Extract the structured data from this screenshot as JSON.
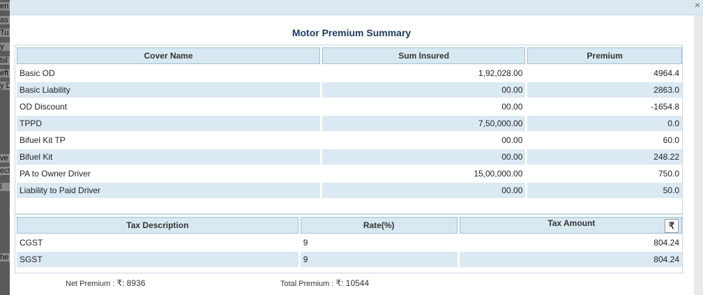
{
  "backdrop": {
    "fragments": [
      "en",
      "as",
      "Tu",
      "y",
      "bil",
      "eft",
      "y D",
      "ve",
      "ect",
      "l",
      "he"
    ]
  },
  "modal": {
    "title": "Motor Premium Summary",
    "close_icon": "×"
  },
  "cover_table": {
    "headers": [
      "Cover Name",
      "Sum Insured",
      "Premium"
    ],
    "rows": [
      {
        "name": "Basic OD",
        "sum": "1,92,028.00",
        "premium": "4964.4"
      },
      {
        "name": "Basic Liability",
        "sum": "00.00",
        "premium": "2863.0"
      },
      {
        "name": "OD Discount",
        "sum": "00.00",
        "premium": "-1654.8"
      },
      {
        "name": "TPPD",
        "sum": "7,50,000.00",
        "premium": "0.0"
      },
      {
        "name": "Bifuel Kit TP",
        "sum": "00.00",
        "premium": "60.0"
      },
      {
        "name": "Bifuel Kit",
        "sum": "00.00",
        "premium": "248.22"
      },
      {
        "name": "PA to Owner Driver",
        "sum": "15,00,000.00",
        "premium": "750.0"
      },
      {
        "name": "Liability to Paid Driver",
        "sum": "00.00",
        "premium": "50.0"
      }
    ]
  },
  "tax_table": {
    "headers": [
      "Tax Description",
      "Rate(%)",
      "Tax Amount"
    ],
    "currency_symbol": "₹",
    "rows": [
      {
        "desc": "CGST",
        "rate": "9",
        "amount": "804.24"
      },
      {
        "desc": "SGST",
        "rate": "9",
        "amount": "804.24"
      }
    ]
  },
  "footer": {
    "net_label": "Net Premium : ",
    "net_currency": "₹",
    "net_value": ": 8936",
    "total_label": "Total Premium : ",
    "total_currency": "₹",
    "total_value": ": 10544"
  }
}
